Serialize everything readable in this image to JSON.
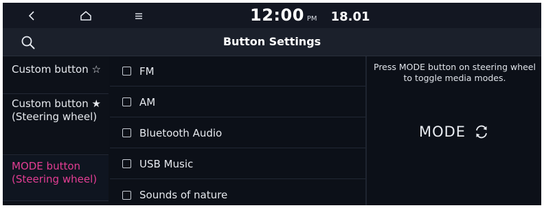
{
  "status_bar": {
    "time": "12:00",
    "ampm": "PM",
    "date": "18.01",
    "icons": [
      "back-icon",
      "home-icon",
      "menu-icon"
    ]
  },
  "header": {
    "title": "Button Settings",
    "search_icon": "search-icon"
  },
  "left_menu": {
    "items": [
      {
        "label": "Custom button ☆",
        "active": false
      },
      {
        "label": "Custom button ★ (Steering wheel)",
        "active": false
      },
      {
        "label": "MODE button (Steering wheel)",
        "active": true
      }
    ]
  },
  "media_options": [
    {
      "label": "FM",
      "checked": false
    },
    {
      "label": "AM",
      "checked": false
    },
    {
      "label": "Bluetooth Audio",
      "checked": false
    },
    {
      "label": "USB Music",
      "checked": false
    },
    {
      "label": "Sounds of nature",
      "checked": false
    }
  ],
  "right_panel": {
    "hint": "Press MODE button on steering wheel to toggle media modes.",
    "mode_label": "MODE",
    "mode_icon": "refresh-cycle-icon"
  },
  "colors": {
    "background": "#0c1018",
    "header": "#1b202b",
    "accent": "#e33d93",
    "text": "#e6e9ee"
  }
}
